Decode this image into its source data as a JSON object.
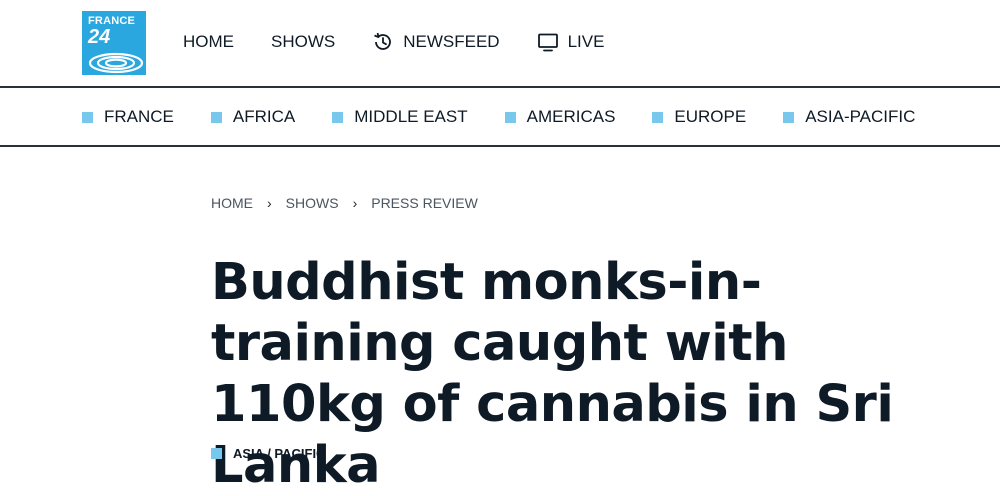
{
  "brand": {
    "logo_line1": "FRANCE",
    "logo_line2": "24",
    "accent_color": "#29a7de",
    "square_color": "#78c8ee"
  },
  "main_nav": {
    "home": "HOME",
    "shows": "SHOWS",
    "newsfeed": "NEWSFEED",
    "live": "LIVE"
  },
  "region_nav": [
    "FRANCE",
    "AFRICA",
    "MIDDLE EAST",
    "AMERICAS",
    "EUROPE",
    "ASIA-PACIFIC"
  ],
  "breadcrumb": [
    "HOME",
    "SHOWS",
    "PRESS REVIEW"
  ],
  "article": {
    "headline": "Buddhist monks-in-training caught with 110kg of cannabis in Sri Lanka",
    "tag": "ASIA / PACIFIC"
  }
}
